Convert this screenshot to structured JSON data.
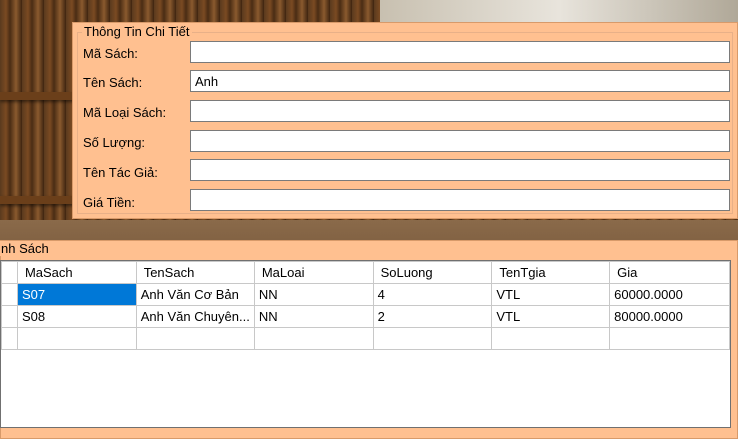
{
  "detail": {
    "title": "Thông Tin Chi Tiết",
    "fields": [
      {
        "label": "Mã Sách:",
        "value": ""
      },
      {
        "label": "Tên Sách:",
        "value": "Anh"
      },
      {
        "label": "Mã Loại Sách:",
        "value": ""
      },
      {
        "label": "Số Lượng:",
        "value": ""
      },
      {
        "label": "Tên Tác Giả:",
        "value": ""
      },
      {
        "label": "Giá Tiền:",
        "value": ""
      }
    ]
  },
  "list": {
    "title": "nh Sách",
    "columns": [
      "MaSach",
      "TenSach",
      "MaLoai",
      "SoLuong",
      "TenTgia",
      "Gia"
    ],
    "rows": [
      [
        "S07",
        "Anh Văn Cơ Bản",
        "NN",
        "4",
        "VTL",
        "60000.0000"
      ],
      [
        "S08",
        "Anh Văn Chuyên...",
        "NN",
        "2",
        "VTL",
        "80000.0000"
      ]
    ]
  },
  "colors": {
    "panel": "#ffc090",
    "selection": "#0078d7"
  }
}
